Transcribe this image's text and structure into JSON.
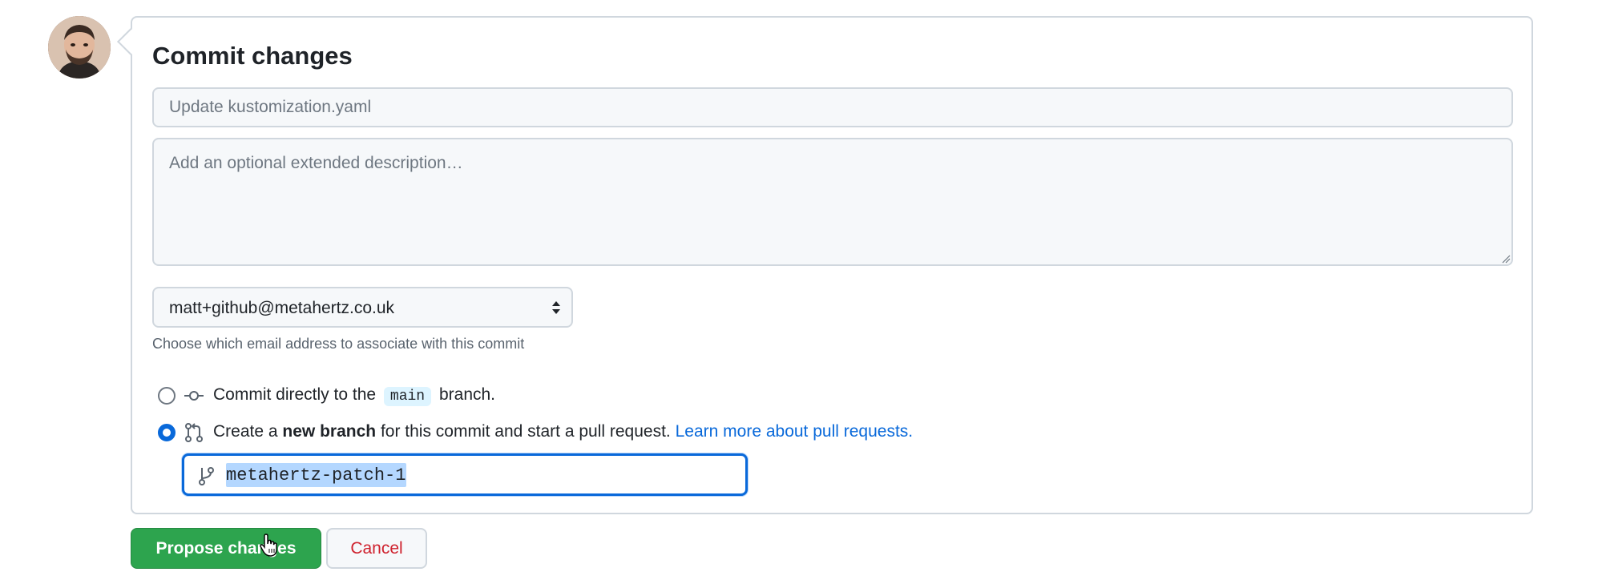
{
  "form": {
    "title": "Commit changes",
    "summary_placeholder": "Update kustomization.yaml",
    "description_placeholder": "Add an optional extended description…",
    "email": {
      "selected": "matt+github@metahertz.co.uk",
      "note": "Choose which email address to associate with this commit"
    },
    "options": {
      "direct": {
        "prefix": "Commit directly to the",
        "branch": "main",
        "suffix": "branch.",
        "checked": false,
        "icon": "git-commit-icon"
      },
      "new_branch": {
        "prefix": "Create a",
        "bold": "new branch",
        "middle": "for this commit and start a pull request.",
        "link": "Learn more about pull requests.",
        "checked": true,
        "icon": "git-pull-request-icon"
      }
    },
    "branch_name": "metahertz-patch-1"
  },
  "buttons": {
    "propose": "Propose changes",
    "cancel": "Cancel"
  },
  "colors": {
    "accent": "#0969da",
    "primary_button": "#2da44e",
    "danger_text": "#cf222e",
    "border": "#d0d7de"
  }
}
